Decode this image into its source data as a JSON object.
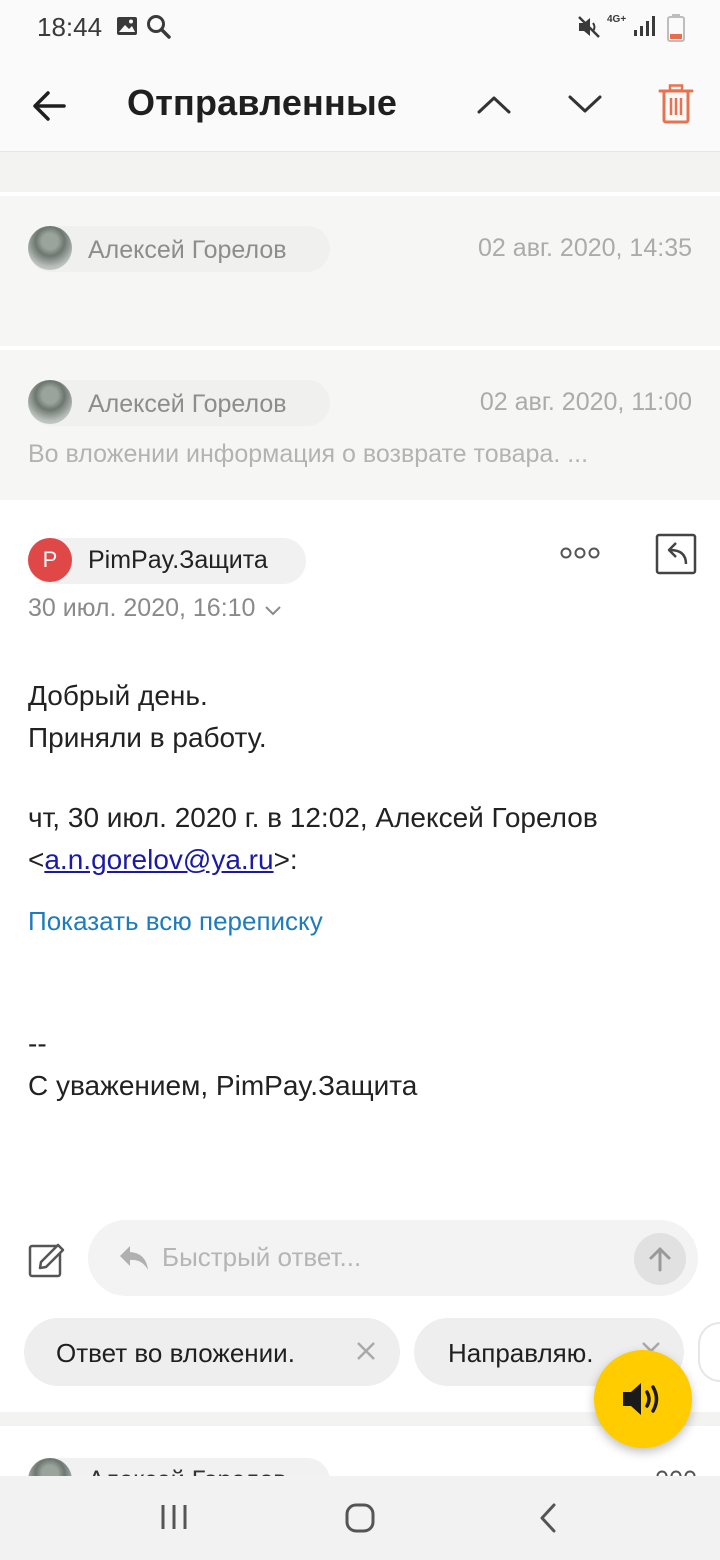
{
  "status_bar": {
    "time": "18:44",
    "network": "4G+"
  },
  "header": {
    "title": "Отправленные"
  },
  "thread": [
    {
      "sender": "Алексей Горелов",
      "date": "02 авг. 2020, 14:35",
      "snippet": ""
    },
    {
      "sender": "Алексей Горелов",
      "date": "02 авг. 2020, 11:00",
      "snippet": "Во вложении информация о возврате товара. ..."
    }
  ],
  "message": {
    "avatar_letter": "P",
    "sender": "PimPay.Защита",
    "date": "30 июл. 2020, 16:10",
    "greeting": "Добрый день.",
    "line2": "Приняли в работу.",
    "quote_header": "чт, 30 июл. 2020 г. в 12:02, Алексей Горелов",
    "quote_email": "a.n.gorelov@ya.ru",
    "quote_open": "<",
    "quote_close": ">:",
    "show_all": "Показать всю переписку",
    "sig_dash": "--",
    "signature": "С уважением, PimPay.Защита"
  },
  "quick_reply": {
    "placeholder": "Быстрый ответ..."
  },
  "suggestions": [
    {
      "label": "Ответ во вложении."
    },
    {
      "label": "Направляю."
    }
  ],
  "next_preview": {
    "sender": "Алексей Горелов"
  },
  "colors": {
    "accent_link": "#1e7bbd",
    "fab": "#ffcc00",
    "avatar_p": "#e04848",
    "delete": "#e8714f"
  }
}
